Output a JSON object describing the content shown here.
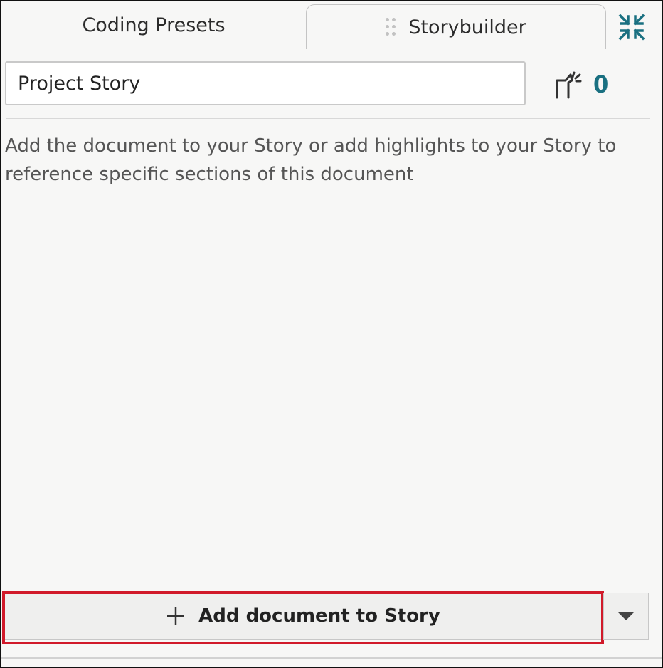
{
  "tabs": [
    {
      "label": "Coding Presets",
      "active": false
    },
    {
      "label": "Storybuilder",
      "active": true
    }
  ],
  "story": {
    "name_value": "Project Story",
    "highlight_count": "0",
    "hint_text": "Add the document to your Story or add highlights to your Story to reference specific sections of this document"
  },
  "actions": {
    "add_label": "Add document to Story"
  },
  "icons": {
    "drag": "drag-handle-icon",
    "collapse": "collapse-arrows-icon",
    "highlight": "highlight-count-icon",
    "add": "plus-icon",
    "dropdown": "caret-down-icon"
  },
  "colors": {
    "accent": "#1a7081",
    "highlight_outline": "#d11a2a"
  }
}
